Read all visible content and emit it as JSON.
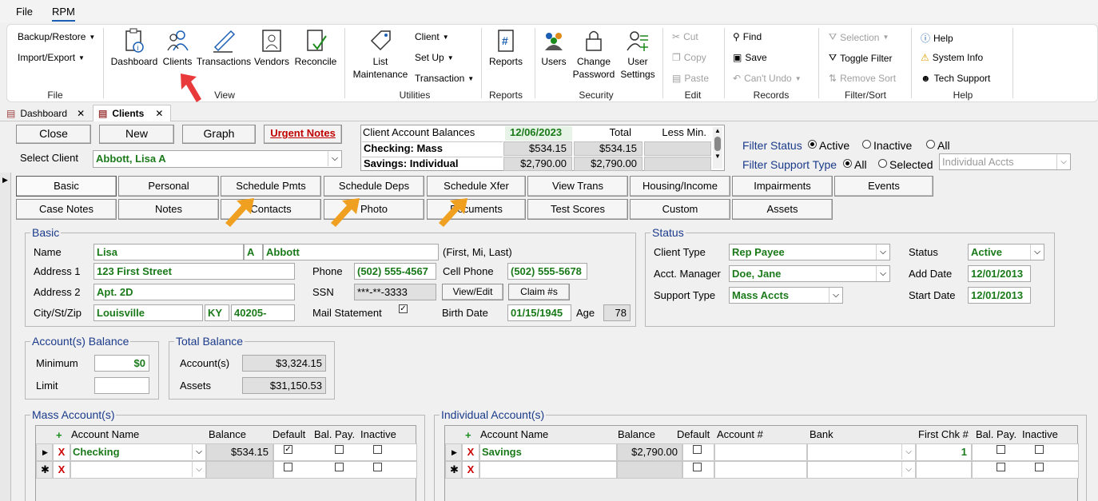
{
  "menubar": {
    "file": "File",
    "rpm": "RPM"
  },
  "ribbon": {
    "file_group": {
      "backup": "Backup/Restore",
      "import": "Import/Export",
      "label": "File"
    },
    "view_group": {
      "dashboard": "Dashboard",
      "clients": "Clients",
      "transactions": "Transactions",
      "vendors": "Vendors",
      "reconcile": "Reconcile",
      "label": "View"
    },
    "utilities_group": {
      "list_line1": "List",
      "list_line2": "Maintenance",
      "client": "Client",
      "setup": "Set Up",
      "transaction": "Transaction",
      "label": "Utilities"
    },
    "reports_group": {
      "reports": "Reports",
      "label": "Reports"
    },
    "security_group": {
      "users": "Users",
      "change_line1": "Change",
      "change_line2": "Password",
      "usersettings_line1": "User",
      "usersettings_line2": "Settings",
      "label": "Security"
    },
    "edit_group": {
      "cut": "Cut",
      "copy": "Copy",
      "paste": "Paste",
      "label": "Edit"
    },
    "records_group": {
      "find": "Find",
      "save": "Save",
      "cantundo": "Can't Undo",
      "label": "Records"
    },
    "filter_group": {
      "selection": "Selection",
      "toggle": "Toggle Filter",
      "remove": "Remove Sort",
      "label": "Filter/Sort"
    },
    "help_group": {
      "help": "Help",
      "sysinfo": "System Info",
      "tech": "Tech Support",
      "label": "Help"
    }
  },
  "doctabs": [
    {
      "label": "Dashboard"
    },
    {
      "label": "Clients"
    }
  ],
  "top": {
    "close": "Close",
    "new": "New",
    "graph": "Graph",
    "urgent": "Urgent Notes",
    "select_client_label": "Select Client",
    "select_client_value": "Abbott, Lisa A"
  },
  "balances": {
    "title": "Client Account Balances",
    "date": "12/06/2023",
    "total": "Total",
    "lessmin": "Less Min.",
    "rows": [
      {
        "name": "Checking: Mass",
        "bal": "$534.15",
        "total": "$534.15"
      },
      {
        "name": "Savings: Individual",
        "bal": "$2,790.00",
        "total": "$2,790.00"
      }
    ]
  },
  "filters": {
    "status_label": "Filter Status",
    "active": "Active",
    "inactive": "Inactive",
    "all": "All",
    "support_label": "Filter Support Type",
    "all2": "All",
    "selected": "Selected",
    "support_value": "Individual Accts"
  },
  "formtabs": {
    "row1": [
      "Basic",
      "Personal",
      "Schedule Pmts",
      "Schedule Deps",
      "Schedule Xfer",
      "View Trans",
      "Housing/Income",
      "Impairments",
      "Events"
    ],
    "row2": [
      "Case Notes",
      "Notes",
      "Contacts",
      "Photo",
      "Documents",
      "Test Scores",
      "Custom",
      "Assets"
    ]
  },
  "basic": {
    "title": "Basic",
    "name_label": "Name",
    "first": "Lisa",
    "mi": "A",
    "last": "Abbott",
    "name_hint": "(First, Mi, Last)",
    "addr1_label": "Address 1",
    "addr1": "123 First Street",
    "addr2_label": "Address 2",
    "addr2": "Apt. 2D",
    "city_label": "City/St/Zip",
    "city": "Louisville",
    "state": "KY",
    "zip": "40205-",
    "phone_label": "Phone",
    "phone": "(502) 555-4567",
    "cell_label": "Cell Phone",
    "cell": "(502) 555-5678",
    "ssn_label": "SSN",
    "ssn": "***-**-3333",
    "viewedit": "View/Edit",
    "claim": "Claim #s",
    "mail_label": "Mail Statement",
    "birth_label": "Birth Date",
    "birth": "01/15/1945",
    "age_label": "Age",
    "age": "78"
  },
  "status": {
    "title": "Status",
    "clienttype_label": "Client Type",
    "clienttype": "Rep Payee",
    "manager_label": "Acct. Manager",
    "manager": "Doe, Jane",
    "support_label": "Support Type",
    "support": "Mass Accts",
    "status_label": "Status",
    "status": "Active",
    "adddate_label": "Add Date",
    "adddate": "12/01/2013",
    "startdate_label": "Start Date",
    "startdate": "12/01/2013"
  },
  "acctbal": {
    "title": "Account(s) Balance",
    "min_label": "Minimum",
    "min": "$0",
    "limit_label": "Limit"
  },
  "totalbal": {
    "title": "Total Balance",
    "acct_label": "Account(s)",
    "acct": "$3,324.15",
    "assets_label": "Assets",
    "assets": "$31,150.53"
  },
  "mass": {
    "title": "Mass Account(s)",
    "headers": {
      "name": "Account Name",
      "balance": "Balance",
      "default": "Default",
      "balpay": "Bal. Pay.",
      "inactive": "Inactive"
    },
    "row": {
      "name": "Checking",
      "balance": "$534.15"
    }
  },
  "indiv": {
    "title": "Individual Account(s)",
    "headers": {
      "name": "Account Name",
      "balance": "Balance",
      "default": "Default",
      "acctno": "Account #",
      "bank": "Bank",
      "firstchk": "First Chk #",
      "balpay": "Bal. Pay.",
      "inactive": "Inactive"
    },
    "row": {
      "name": "Savings",
      "balance": "$2,790.00",
      "firstchk": "1"
    }
  },
  "colors": {
    "accent": "#1a7a1a",
    "title_blue": "#1a3a8a",
    "urgent_red": "#c00000",
    "arrow_orange": "#f0a020",
    "arrow_red": "#e83a3a"
  }
}
